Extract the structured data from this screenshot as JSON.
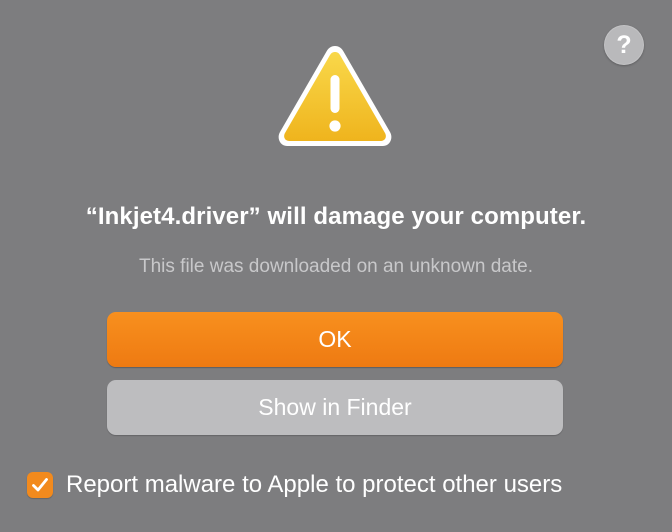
{
  "dialog": {
    "help_button_label": "?",
    "title": "“Inkjet4.driver” will damage your computer.",
    "subtitle": "This file was downloaded on an unknown date.",
    "ok_label": "OK",
    "show_in_finder_label": "Show in Finder",
    "report_label": "Report malware to Apple to protect other users",
    "report_checked": true
  },
  "icons": {
    "warning": "warning-triangle-icon",
    "help": "question-mark-icon",
    "checkmark": "checkmark-icon"
  },
  "colors": {
    "background": "#7d7d7f",
    "accent": "#f28a1d",
    "warning_yellow": "#f5c42a",
    "secondary_button": "#bdbdbf",
    "subtitle_text": "#c8c8ca"
  }
}
